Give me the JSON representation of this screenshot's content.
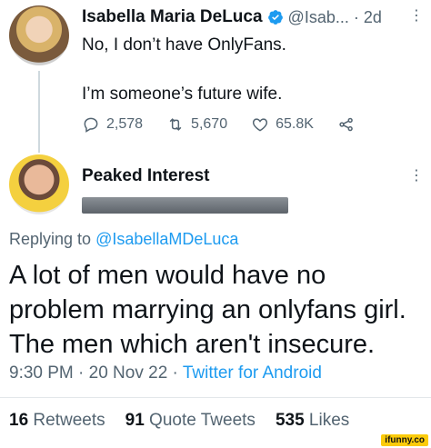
{
  "tweet1": {
    "name": "Isabella Maria DeLuca",
    "handle_time": "@Isab... · 2d",
    "line1": "No, I don’t have OnlyFans.",
    "line2": "I’m someone’s future wife.",
    "replies": "2,578",
    "retweets": "5,670",
    "likes": "65.8K"
  },
  "tweet2": {
    "name": "Peaked Interest",
    "replying_prefix": "Replying to",
    "replying_mention": "@IsabellaMDeLuca",
    "text_lines": [
      "A lot of men would have no",
      "problem marrying an onlyfans girl.",
      "The men which aren't insecure."
    ],
    "time_date": "9:30 PM · 20 Nov 22 ·",
    "source": "Twitter for Android",
    "retweets_count": "16",
    "retweets_label": "Retweets",
    "quotes_count": "91",
    "quotes_label": "Quote Tweets",
    "likes_count": "535",
    "likes_label": "Likes"
  },
  "watermark": "ifunny.co",
  "colors": {
    "accent": "#1d9bf0",
    "muted": "#536471",
    "text": "#0f1419"
  }
}
